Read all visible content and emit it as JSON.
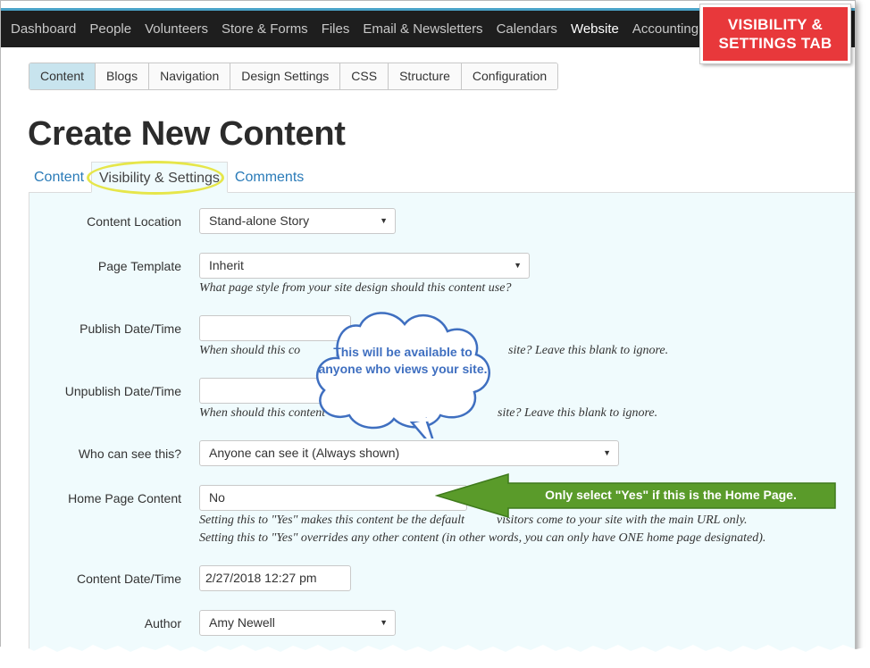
{
  "topnav": {
    "items": [
      "Dashboard",
      "People",
      "Volunteers",
      "Store & Forms",
      "Files",
      "Email & Newsletters",
      "Calendars",
      "Website",
      "Accounting"
    ],
    "active_index": 7
  },
  "callout": {
    "line1": "VISIBILITY &",
    "line2": "SETTINGS TAB"
  },
  "subnav": {
    "items": [
      "Content",
      "Blogs",
      "Navigation",
      "Design Settings",
      "CSS",
      "Structure",
      "Configuration"
    ],
    "active_index": 0
  },
  "page_title": "Create New Content",
  "tabs": [
    "Content",
    "Visibility & Settings",
    "Comments"
  ],
  "form": {
    "content_location": {
      "label": "Content Location",
      "value": "Stand-alone Story"
    },
    "page_template": {
      "label": "Page Template",
      "value": "Inherit",
      "help": "What page style from your site design should this content use?"
    },
    "publish": {
      "label": "Publish Date/Time",
      "value": "",
      "help_start": "When should this co",
      "help_end": "site? Leave this blank to ignore."
    },
    "unpublish": {
      "label": "Unpublish Date/Time",
      "value": "",
      "help_start": "When should this content",
      "help_end": "site? Leave this blank to ignore."
    },
    "who_can_see": {
      "label": "Who can see this?",
      "value": "Anyone can see it (Always shown)"
    },
    "home_page": {
      "label": "Home Page Content",
      "value": "No",
      "help1_start": "Setting this to \"Yes\" makes this content be the default ",
      "help1_end": "visitors come to your site with the main URL only.",
      "help2": "Setting this to \"Yes\" overrides any other content (in other words, you can only have ONE home page designated)."
    },
    "content_date": {
      "label": "Content Date/Time",
      "value": "2/27/2018 12:27 pm"
    },
    "author": {
      "label": "Author",
      "value": "Amy Newell"
    }
  },
  "cloud_note": "This will be available to anyone who views your site.",
  "arrow_note": "Only select \"Yes\" if this is the Home Page.",
  "colors": {
    "nav_bg": "#1e1e1e",
    "callout_red": "#e8383b",
    "panel_bg": "#f0fbfd",
    "arrow_green": "#5a9b2a",
    "cloud_text": "#3f6fc0",
    "highlight": "#e6e64a"
  }
}
